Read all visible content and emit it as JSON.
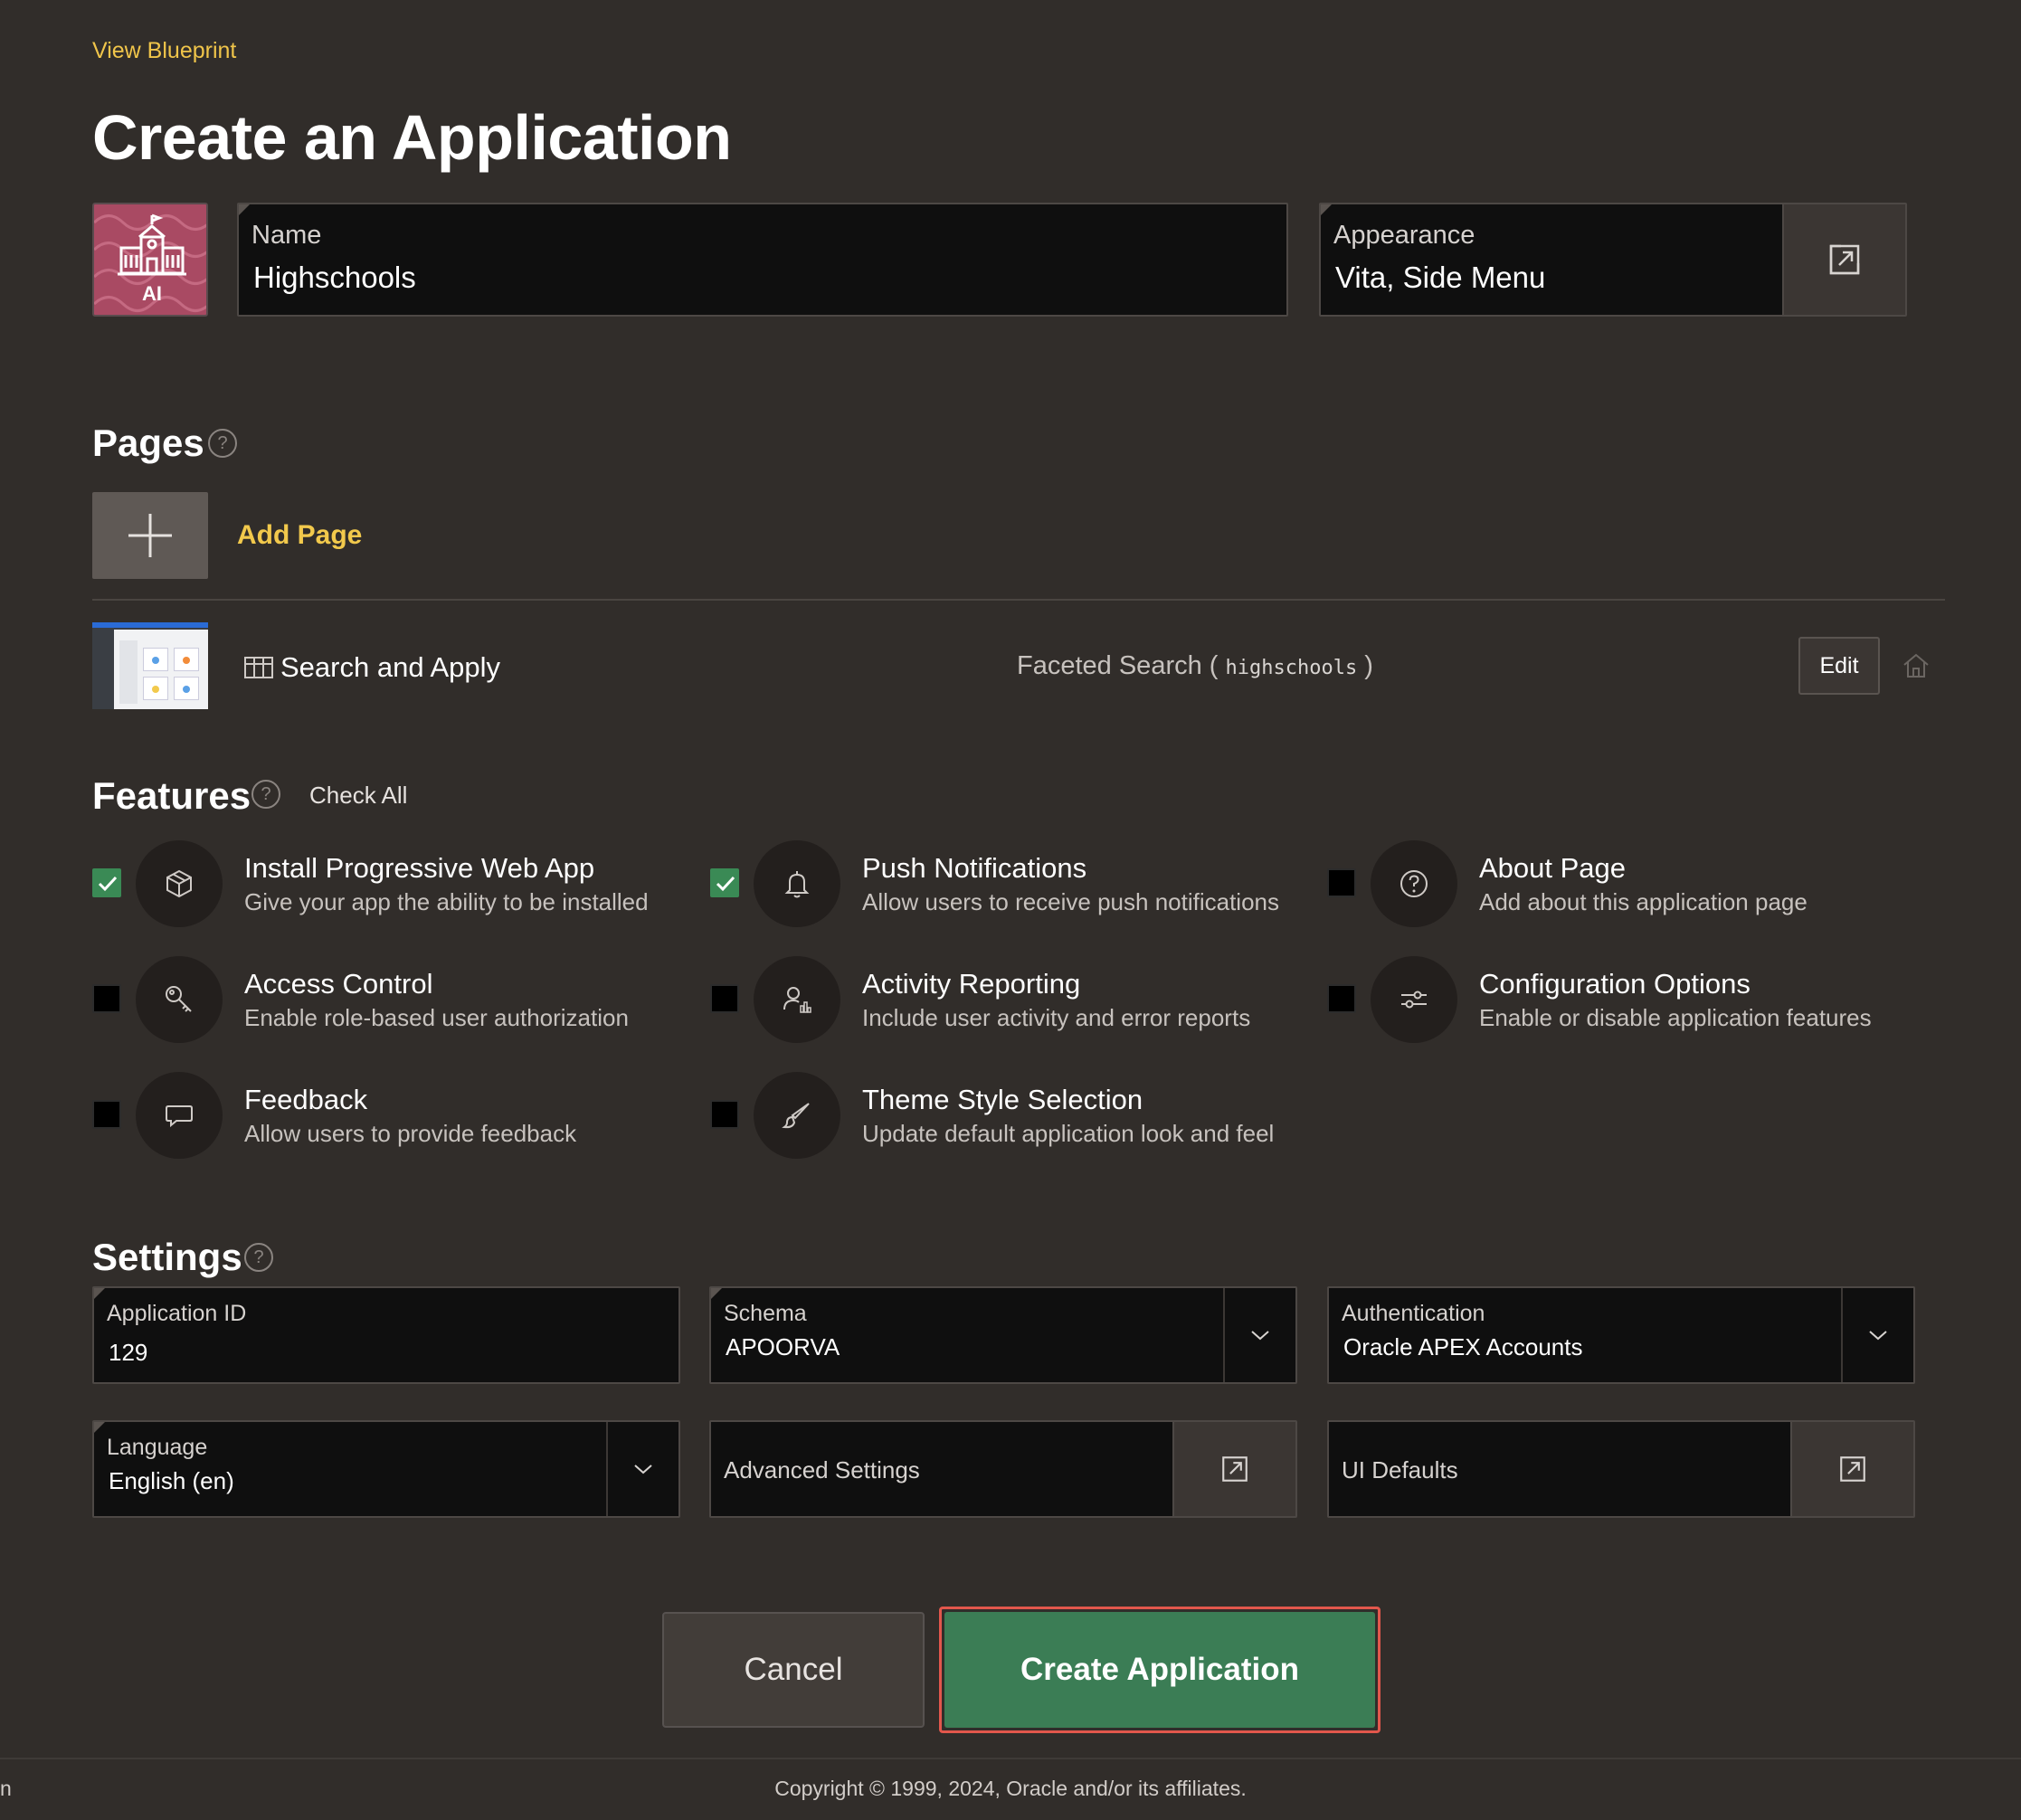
{
  "header": {
    "view_blueprint": "View Blueprint",
    "title": "Create an Application"
  },
  "app_icon": {
    "badge": "AI",
    "icon_name": "school-building-icon",
    "color": "#a94a63"
  },
  "name_field": {
    "label": "Name",
    "value": "Highschools"
  },
  "appearance_field": {
    "label": "Appearance",
    "value": "Vita, Side Menu",
    "icon_name": "open-dialog-icon"
  },
  "pages": {
    "heading": "Pages",
    "add_page_label": "Add Page",
    "items": [
      {
        "name": "Search and Apply",
        "type_label": "Faceted Search",
        "paren_open": "(",
        "table": "highschools",
        "paren_close": ")",
        "edit_label": "Edit",
        "icon_name": "grid-table-icon",
        "home_icon_name": "home-icon"
      }
    ]
  },
  "features": {
    "heading": "Features",
    "check_all_label": "Check All",
    "items": [
      {
        "title": "Install Progressive Web App",
        "desc": "Give your app the ability to be installed",
        "checked": true,
        "icon": "cube-icon"
      },
      {
        "title": "Push Notifications",
        "desc": "Allow users to receive push notifications",
        "checked": true,
        "icon": "bell-icon"
      },
      {
        "title": "About Page",
        "desc": "Add about this application page",
        "checked": false,
        "icon": "question-circle-icon"
      },
      {
        "title": "Access Control",
        "desc": "Enable role-based user authorization",
        "checked": false,
        "icon": "key-icon"
      },
      {
        "title": "Activity Reporting",
        "desc": "Include user activity and error reports",
        "checked": false,
        "icon": "user-chart-icon"
      },
      {
        "title": "Configuration Options",
        "desc": "Enable or disable application features",
        "checked": false,
        "icon": "sliders-icon"
      },
      {
        "title": "Feedback",
        "desc": "Allow users to provide feedback",
        "checked": false,
        "icon": "speech-bubble-icon"
      },
      {
        "title": "Theme Style Selection",
        "desc": "Update default application look and feel",
        "checked": false,
        "icon": "paintbrush-icon"
      }
    ]
  },
  "settings": {
    "heading": "Settings",
    "application_id": {
      "label": "Application ID",
      "value": "129"
    },
    "schema": {
      "label": "Schema",
      "value": "APOORVA"
    },
    "authentication": {
      "label": "Authentication",
      "value": "Oracle APEX Accounts"
    },
    "language": {
      "label": "Language",
      "value": "English (en)"
    },
    "advanced_settings": {
      "label": "Advanced Settings"
    },
    "ui_defaults": {
      "label": "UI Defaults"
    }
  },
  "actions": {
    "cancel_label": "Cancel",
    "create_label": "Create Application",
    "create_color": "#3b7d55",
    "highlight_color": "#e2574c"
  },
  "footer": {
    "copyright": "Copyright © 1999, 2024, Oracle and/or its affiliates.",
    "edge_text": "n"
  }
}
